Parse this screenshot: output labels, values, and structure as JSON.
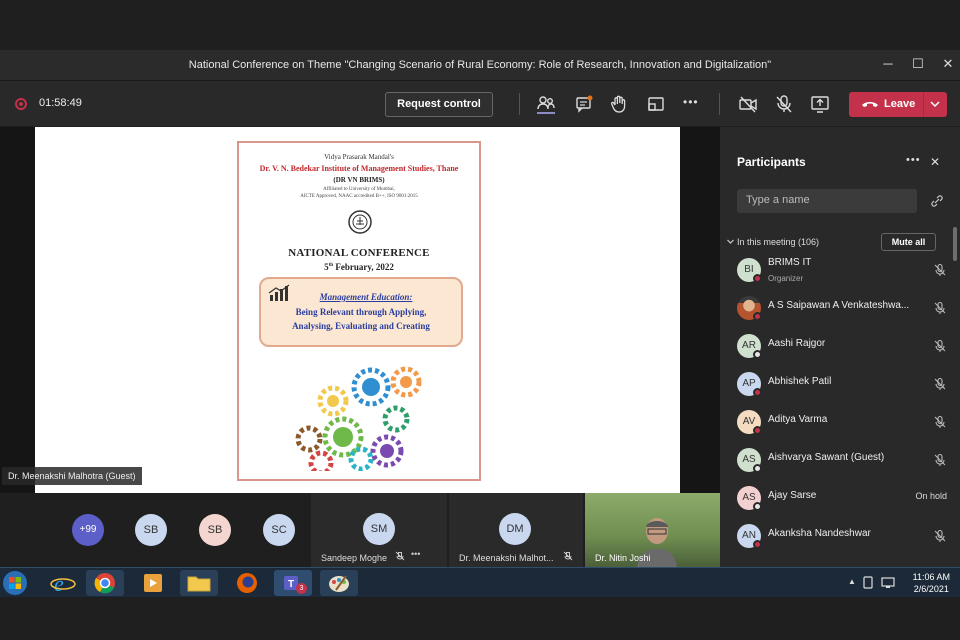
{
  "window": {
    "title": "National Conference on Theme \"Changing Scenario of Rural Economy: Role of Research, Innovation and Digitalization\"",
    "minimize": "─",
    "maximize": "☐",
    "close": "✕"
  },
  "toolbar": {
    "timer": "01:58:49",
    "request_control": "Request control",
    "more": "•••",
    "leave": "Leave"
  },
  "slide": {
    "org": "Vidya Prasarak Mandal's",
    "institute": "Dr. V. N. Bedekar Institute of Management Studies, Thane",
    "short_name": "(DR VN BRIMS)",
    "affiliation1": "Affiliated to University of Mumbai,",
    "affiliation2": "AICTE Approved, NAAC accredited B++, ISO 9001:2015",
    "event": "NATIONAL CONFERENCE",
    "date_day": "5",
    "date_sup": "th",
    "date_rest": " February, 2022",
    "theme_title": "Management Education:",
    "theme_line1": "Being Relevant through Applying,",
    "theme_line2": "Analysing, Evaluating and Creating"
  },
  "presenter_tag": "Dr. Meenakshi Malhotra (Guest)",
  "panel": {
    "title": "Participants",
    "more": "•••",
    "close": "✕",
    "search_placeholder": "Type a name",
    "in_meeting": "In this meeting (106)",
    "mute_all": "Mute all",
    "participants": [
      {
        "initials": "BI",
        "name": "BRIMS IT",
        "role": "Organizer",
        "color": "#cfe0cf",
        "status": "hold-red",
        "right": "mic-off"
      },
      {
        "initials": "",
        "name": "A S Saipawan A Venkateshwa...",
        "role": "",
        "color": "#b5542e",
        "status": "red",
        "right": "mic-off"
      },
      {
        "initials": "AR",
        "name": "Aashi Rajgor",
        "role": "",
        "color": "#cfe0cf",
        "status": "white",
        "right": "mic-off"
      },
      {
        "initials": "AP",
        "name": "Abhishek Patil",
        "role": "",
        "color": "#c9d8ef",
        "status": "red",
        "right": "mic-off"
      },
      {
        "initials": "AV",
        "name": "Aditya Varma",
        "role": "",
        "color": "#f5dcc0",
        "status": "red",
        "right": "mic-off"
      },
      {
        "initials": "AS",
        "name": "Aishvarya Sawant (Guest)",
        "role": "",
        "color": "#cfe0cf",
        "status": "white",
        "right": "mic-off"
      },
      {
        "initials": "AS",
        "name": "Ajay Sarse",
        "role": "",
        "color": "#f3d0d0",
        "status": "white",
        "right": "On hold"
      },
      {
        "initials": "AN",
        "name": "Akanksha Nandeshwar",
        "role": "",
        "color": "#c9d8ef",
        "status": "red",
        "right": "mic-off"
      }
    ]
  },
  "strip": {
    "overflow": "+99",
    "avatars": [
      {
        "initials": "SB",
        "color": "#c9d8ef"
      },
      {
        "initials": "SB",
        "color": "#f5d5cf"
      },
      {
        "initials": "SC",
        "color": "#c9d8ef"
      }
    ],
    "tiles": [
      {
        "initials": "SM",
        "name": "Sandeep Moghe"
      },
      {
        "initials": "DM",
        "name": "Dr. Meenakshi Malhot..."
      },
      {
        "initials": "",
        "name": "Dr. Nitin Joshi"
      }
    ]
  },
  "taskbar": {
    "time": "11:06 AM",
    "date": "2/6/2021",
    "teams_badge": "3"
  }
}
